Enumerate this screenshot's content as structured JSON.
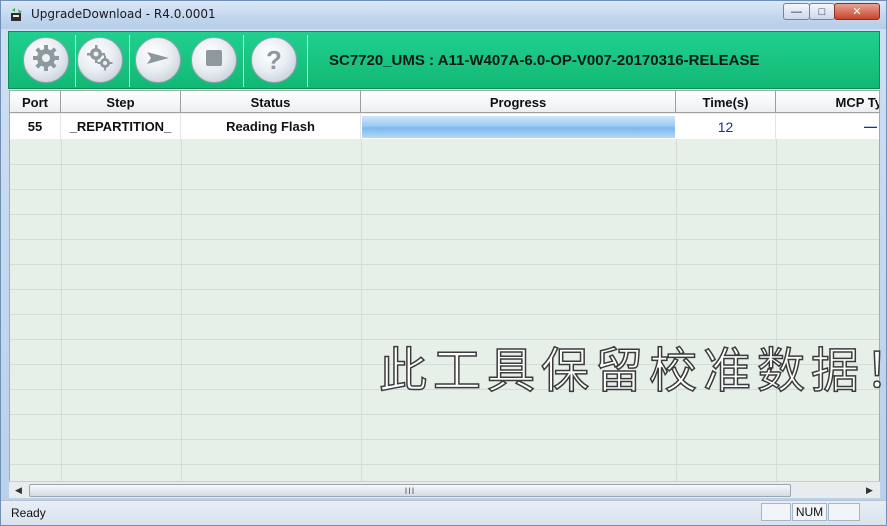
{
  "window": {
    "title": "UpgradeDownload - R4.0.0001"
  },
  "toolbar": {
    "buttons": [
      {
        "icon": "gear-icon"
      },
      {
        "icon": "gears-icon"
      },
      {
        "icon": "play-arrow-icon"
      },
      {
        "icon": "stop-icon"
      },
      {
        "icon": "help-icon",
        "glyph": "?"
      }
    ],
    "project_title": "SC7720_UMS : A11-W407A-6.0-OP-V007-20170316-RELEASE",
    "accent": "#16c17f"
  },
  "table": {
    "columns": [
      "Port",
      "Step",
      "Status",
      "Progress",
      "Time(s)",
      "MCP Ty"
    ],
    "rows": [
      {
        "port": "55",
        "step": "_REPARTITION_",
        "status": "Reading Flash",
        "progress": 1.0,
        "time": "12",
        "mcp": "—"
      }
    ]
  },
  "scrollbar": {
    "thumb_grip": "III"
  },
  "watermark": "此工具保留校准数据！",
  "statusbar": {
    "text": "Ready",
    "num": "NUM"
  }
}
